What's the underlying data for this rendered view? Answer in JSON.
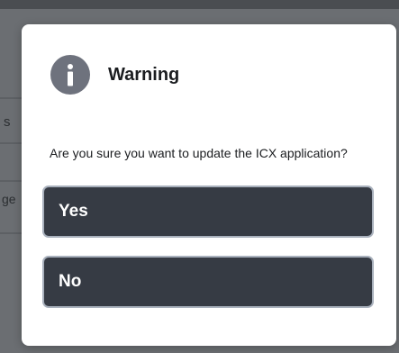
{
  "background": {
    "fragment_1": "s",
    "fragment_2": "ge"
  },
  "dialog": {
    "icon": "info-icon",
    "title": "Warning",
    "message": "Are you sure you want to update the ICX application?",
    "buttons": {
      "yes_label": "Yes",
      "no_label": "No"
    }
  },
  "colors": {
    "button_bg": "#363b44",
    "button_border": "#a9b1bd",
    "icon_bg": "#6e727d",
    "overlay": "#6b6e72"
  }
}
